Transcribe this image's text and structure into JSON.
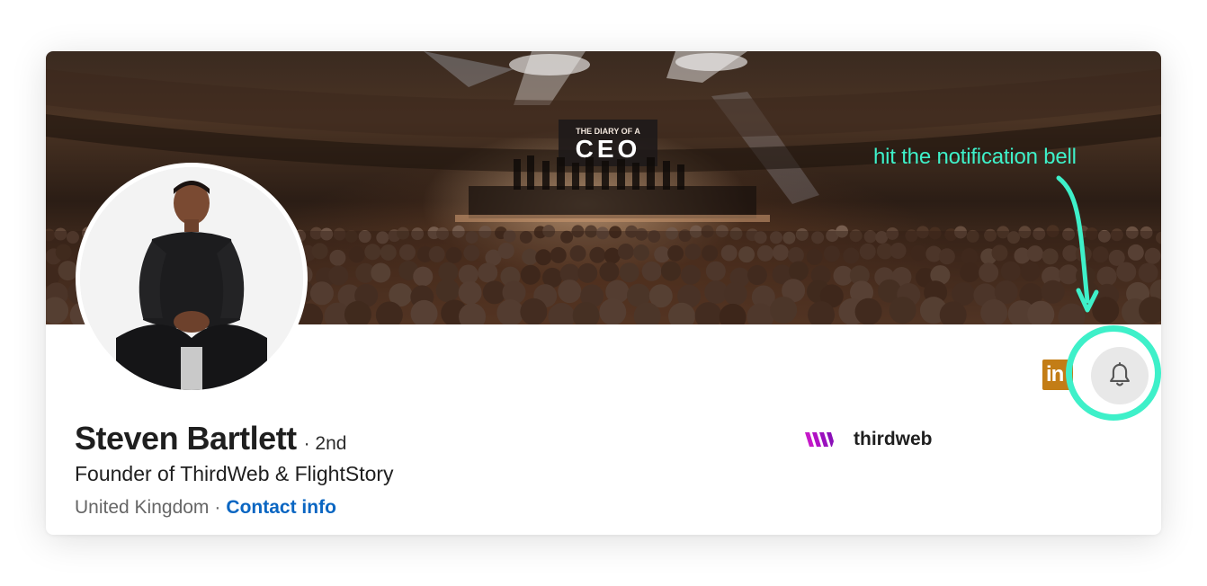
{
  "profile": {
    "name": "Steven Bartlett",
    "degree": "· 2nd",
    "headline": "Founder of ThirdWeb & FlightStory",
    "location": "United Kingdom",
    "separator": "·",
    "contact_label": "Contact info"
  },
  "banner": {
    "stage_sign": "THE DIARY OF A",
    "stage_sign_big": "CEO"
  },
  "company": {
    "name": "thirdweb",
    "logo_icon": "thirdweb-logo-icon"
  },
  "actions": {
    "linkedin_badge": "in",
    "bell_icon": "bell-icon"
  },
  "annotation": {
    "text": "hit the notification bell",
    "color": "#3ef0c9"
  },
  "colors": {
    "link": "#0a66c2",
    "accent_annotation": "#3ef0c9",
    "linkedin_badge": "#c37d16",
    "thirdweb_brand": "#c619c9"
  }
}
